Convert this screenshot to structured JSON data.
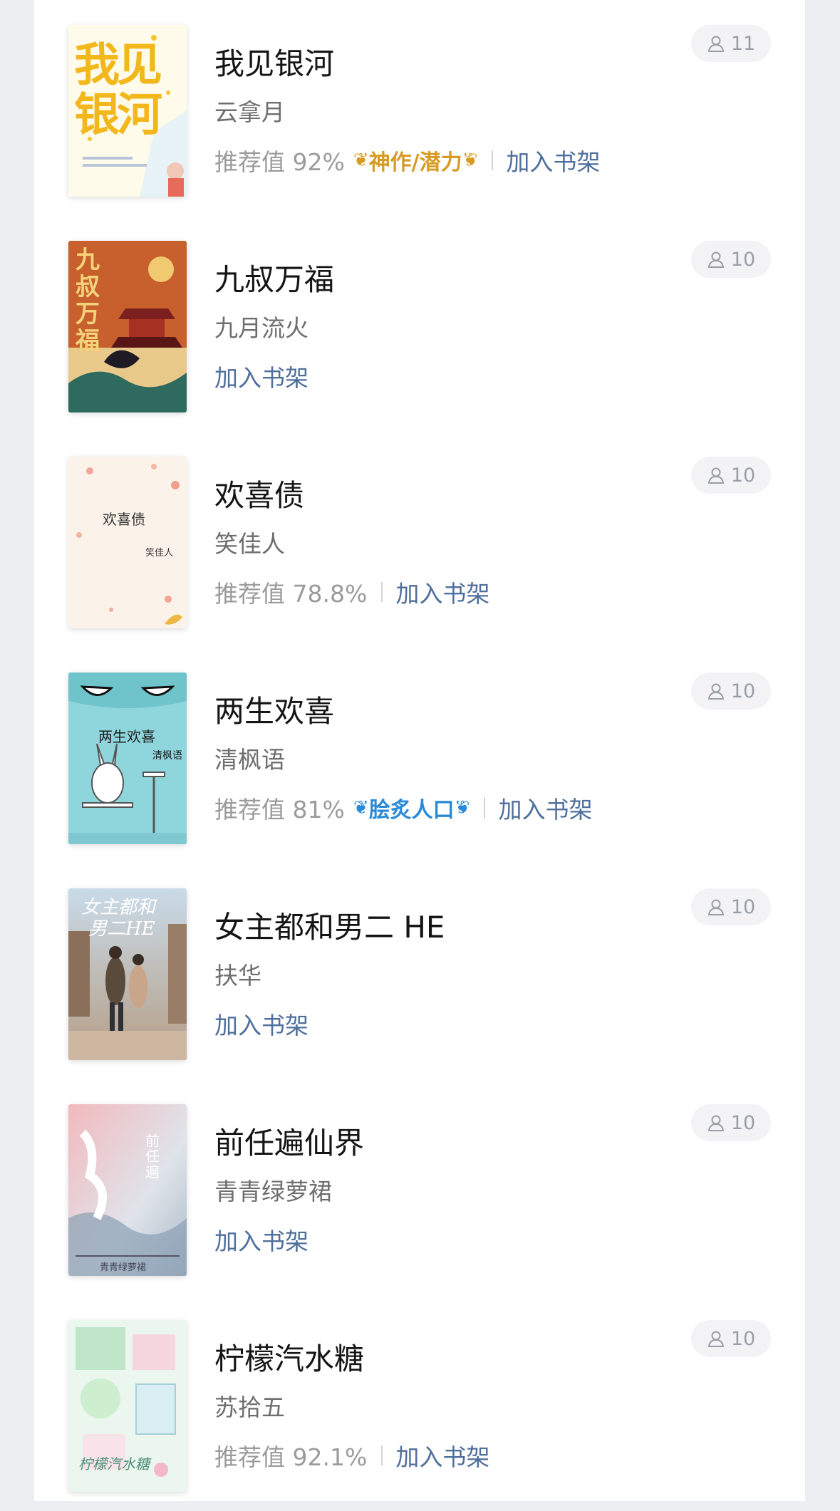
{
  "colors": {
    "link": "#4f6f9c",
    "muted": "#9b9b9b",
    "gold_badge": "#d79a22",
    "blue_badge": "#2a8ad8"
  },
  "icons": {
    "readers": "user-icon",
    "badge_decoration": "laurel-icon"
  },
  "books": [
    {
      "title": "我见银河",
      "author": "云拿月",
      "readers": "11",
      "recommend": "推荐值 92%",
      "badge": "神作/潜力",
      "badge_style": "gold",
      "add_label": "加入书架",
      "cover_text": [
        "我见",
        "银河"
      ]
    },
    {
      "title": "九叔万福",
      "author": "九月流火",
      "readers": "10",
      "add_label": "加入书架",
      "cover_text": [
        "九叔万福"
      ]
    },
    {
      "title": "欢喜债",
      "author": "笑佳人",
      "readers": "10",
      "recommend": "推荐值 78.8%",
      "add_label": "加入书架",
      "cover_text": [
        "欢喜债",
        "笑佳人"
      ]
    },
    {
      "title": "两生欢喜",
      "author": "清枫语",
      "readers": "10",
      "recommend": "推荐值 81%",
      "badge": "脍炙人口",
      "badge_style": "blue",
      "add_label": "加入书架",
      "cover_text": [
        "两生欢喜",
        "清枫语"
      ]
    },
    {
      "title": "女主都和男二 HE",
      "author": "扶华",
      "readers": "10",
      "add_label": "加入书架",
      "cover_text": [
        "女主都和",
        "男二HE"
      ]
    },
    {
      "title": "前任遍仙界",
      "author": "青青绿萝裙",
      "readers": "10",
      "add_label": "加入书架",
      "cover_text": [
        "前任遍",
        "青青绿萝裙"
      ]
    },
    {
      "title": "柠檬汽水糖",
      "author": "苏拾五",
      "readers": "10",
      "recommend": "推荐值 92.1%",
      "add_label": "加入书架",
      "cover_text": [
        "柠檬汽水糖"
      ]
    }
  ]
}
